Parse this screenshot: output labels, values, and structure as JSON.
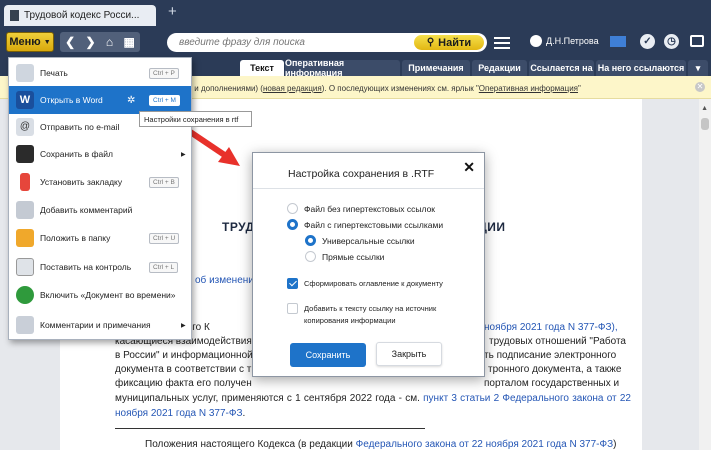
{
  "browser": {
    "tab_title": "Трудовой кодекс Росси...",
    "new_tab": "+"
  },
  "toolbar": {
    "menu_label": "Меню",
    "search_placeholder": "введите фразу для поиска",
    "find_label": "Найти",
    "user_name": "Д.Н.Петрова"
  },
  "doc_tabs": [
    {
      "label": "Текст",
      "active": true
    },
    {
      "label": "Оперативная информация",
      "active": false
    },
    {
      "label": "Примечания",
      "active": false
    },
    {
      "label": "Редакции",
      "active": false
    },
    {
      "label": "Ссылается на",
      "active": false
    },
    {
      "label": "На него ссылаются",
      "active": false
    }
  ],
  "infobar": {
    "prefix": "нениями и дополнениями) (",
    "link1": "новая редакция",
    "middle": "). О последующих изменениях см. ярлык \"",
    "link2": "Оперативная информация",
    "suffix": "\""
  },
  "menu": {
    "items": [
      {
        "label": "Печать",
        "key": "Ctrl + P",
        "submenu": false,
        "icon": "printer-icon"
      },
      {
        "label": "Открыть в Word",
        "key": "Ctrl + M",
        "submenu": false,
        "icon": "word-icon"
      },
      {
        "label": "Отправить по e-mail",
        "key": "",
        "submenu": false,
        "icon": "email-icon"
      },
      {
        "label": "Сохранить в файл",
        "key": "",
        "submenu": true,
        "icon": "save-icon"
      },
      {
        "label": "Установить закладку",
        "key": "Ctrl + B",
        "submenu": false,
        "icon": "bookmark-icon"
      },
      {
        "label": "Добавить комментарий",
        "key": "",
        "submenu": false,
        "icon": "comment-icon"
      },
      {
        "label": "Положить в папку",
        "key": "Ctrl + U",
        "submenu": false,
        "icon": "folder-icon"
      },
      {
        "label": "Поставить на контроль",
        "key": "Ctrl + L",
        "submenu": false,
        "icon": "control-icon"
      },
      {
        "label": "Включить «Документ во времени»",
        "key": "",
        "submenu": false,
        "icon": "clock-icon"
      },
      {
        "label": "Комментарии и примечания",
        "key": "",
        "submenu": true,
        "icon": "notes-icon"
      }
    ],
    "tooltip": "Настройки сохранения в rtf"
  },
  "dialog": {
    "title": "Настройка сохранения в .RTF",
    "close": "✕",
    "opt_no_links": "Файл без гипертекстовых ссылок",
    "opt_with_links": "Файл с гипертекстовыми ссылками",
    "opt_universal": "Универсальные ссылки",
    "opt_direct": "Прямые ссылки",
    "opt_toc": "Сформировать оглавление к документу",
    "opt_source_line1": "Добавить к тексту ссылку на источник",
    "opt_source_line2": "копирования информации",
    "save_label": "Сохранить",
    "close_label": "Закрыть"
  },
  "document": {
    "title_left": "ТРУД",
    "title_right": "ЦИИ",
    "sub_link": "об изменениях",
    "para_lines": [
      "настоящего К",
      "ноября 2021 года N 377-ФЗ),",
      "касающиеся взаимодействия",
      "трудовых отношений \"Работа",
      "в России\" и информационной",
      "ть подписание электронного",
      "документа в соответствии с т",
      "тронного документа, а также",
      "фиксацию факта его получен",
      "порталом государственных и"
    ],
    "para_tail_text": "муниципальных услуг, применяются с 1 сентября 2022 года - см. ",
    "para_tail_link": "пункт 3 статьи 2 Федерального закона от 22 ноября 2021 года N 377-ФЗ",
    "para_tail_end": ".",
    "para2_text": "Положения настоящего Кодекса (в редакции ",
    "para2_link": "Федерального закона от 22 ноября 2021 года N 377-ФЗ",
    "para2_end": ")"
  },
  "colors": {
    "chrome": "#2b3b57",
    "accent": "#1e73c9",
    "menu_button": "#e2b713",
    "arrow": "#e8312b",
    "link": "#2456b5"
  }
}
